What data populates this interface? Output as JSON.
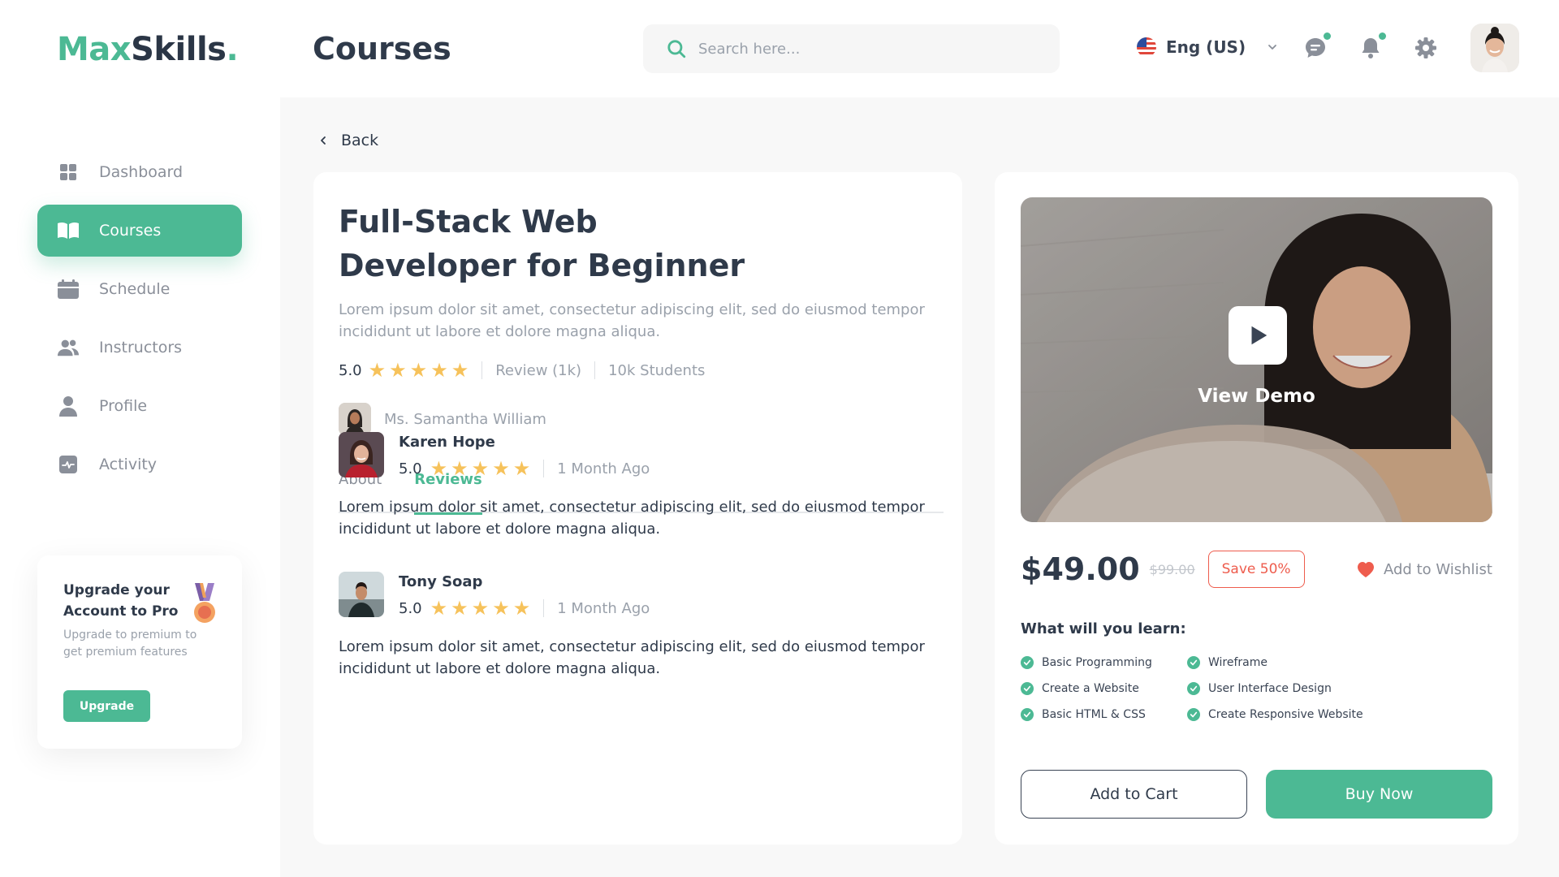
{
  "brand": {
    "part1": "Max",
    "part2": "Skills",
    "dot": "."
  },
  "header": {
    "title": "Courses",
    "search_placeholder": "Search here...",
    "language": "Eng (US)"
  },
  "sidebar": {
    "items": [
      {
        "label": "Dashboard",
        "icon": "dashboard-icon"
      },
      {
        "label": "Courses",
        "icon": "book-icon",
        "active": true
      },
      {
        "label": "Schedule",
        "icon": "calendar-icon"
      },
      {
        "label": "Instructors",
        "icon": "users-icon"
      },
      {
        "label": "Profile",
        "icon": "user-icon"
      },
      {
        "label": "Activity",
        "icon": "activity-icon"
      }
    ],
    "upgrade": {
      "title": "Upgrade your Account to Pro",
      "text": "Upgrade to premium to get premium features",
      "button": "Upgrade"
    }
  },
  "nav": {
    "back": "Back"
  },
  "course": {
    "title": "Full-Stack Web Developer for Beginner",
    "description": "Lorem ipsum dolor sit amet, consectetur adipiscing elit, sed do eiusmod tempor incididunt ut labore et dolore magna aliqua.",
    "rating": "5.0",
    "stars": 5,
    "reviews": "Review (1k)",
    "students": "10k Students",
    "instructor": "Ms. Samantha William"
  },
  "tabs": [
    {
      "label": "About",
      "active": false
    },
    {
      "label": "Reviews",
      "active": true
    }
  ],
  "reviews": [
    {
      "name": "Karen Hope",
      "rating": "5.0",
      "time": "1 Month Ago",
      "text": "Lorem ipsum dolor sit amet, consectetur adipiscing elit, sed do eiusmod tempor incididunt ut labore et dolore magna aliqua."
    },
    {
      "name": "Tony Soap",
      "rating": "5.0",
      "time": "1 Month Ago",
      "text": "Lorem ipsum dolor sit amet, consectetur adipiscing elit, sed do eiusmod tempor incididunt ut labore et dolore magna aliqua."
    }
  ],
  "purchase": {
    "demo_label": "View Demo",
    "price": "$49.00",
    "old_price": "$99.00",
    "save": "Save 50%",
    "wishlist": "Add to Wishlist",
    "learn_title": "What will you learn:",
    "learn_items": [
      "Basic Programming",
      "Wireframe",
      "Create a Website",
      "User Interface Design",
      "Basic HTML & CSS",
      "Create Responsive Website"
    ],
    "add_to_cart": "Add to Cart",
    "buy_now": "Buy Now"
  },
  "colors": {
    "accent": "#4cb994",
    "text": "#2f3a4a",
    "muted": "#9aa1ab",
    "star": "#f6c25b",
    "danger": "#ee5c4d"
  }
}
